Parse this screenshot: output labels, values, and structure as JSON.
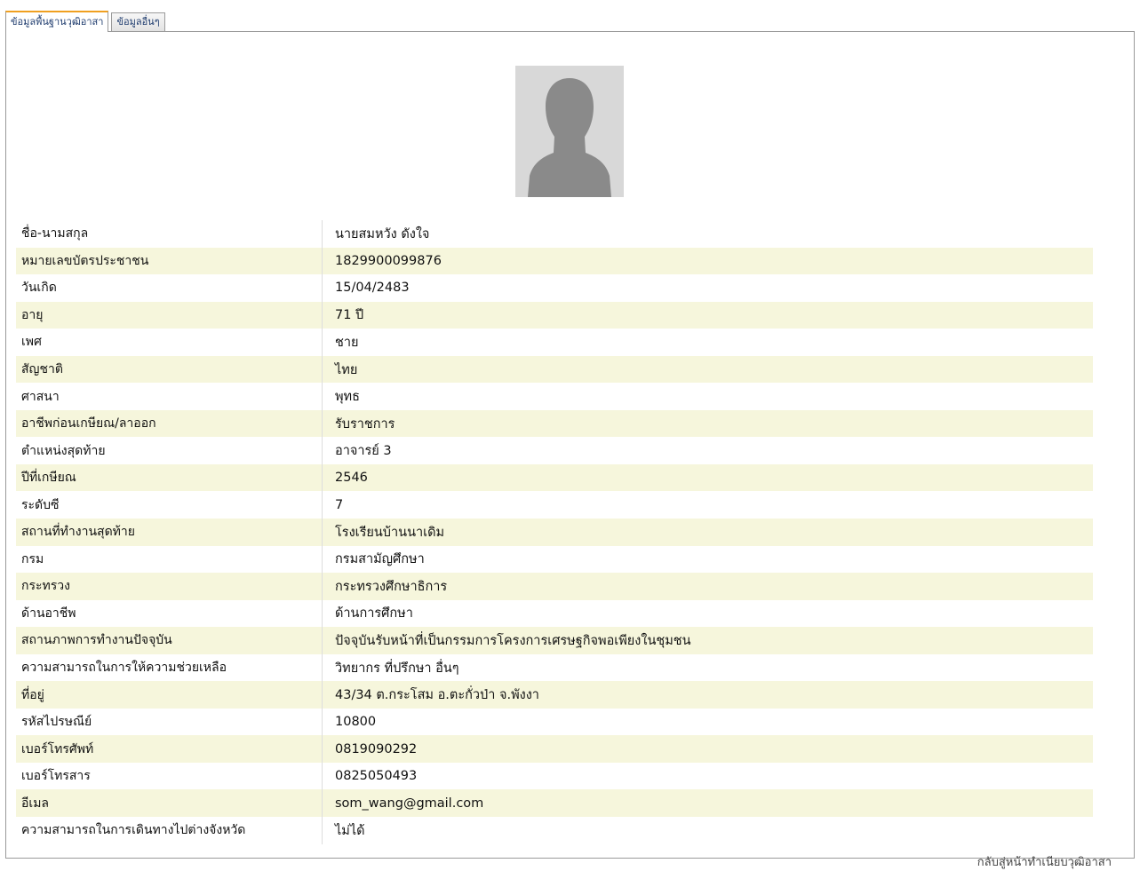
{
  "tabs": [
    {
      "label": "ข้อมูลพื้นฐานวุฒิอาสา",
      "active": true
    },
    {
      "label": "ข้อมูลอื่นๆ",
      "active": false
    }
  ],
  "profile": {
    "rows": [
      {
        "label": "ชื่อ-นามสกุล",
        "value": "นายสมหวัง ดังใจ"
      },
      {
        "label": "หมายเลขบัตรประชาชน",
        "value": "1829900099876"
      },
      {
        "label": "วันเกิด",
        "value": "15/04/2483"
      },
      {
        "label": "อายุ",
        "value": "71  ปี"
      },
      {
        "label": "เพศ",
        "value": "ชาย"
      },
      {
        "label": "สัญชาติ",
        "value": "ไทย"
      },
      {
        "label": "ศาสนา",
        "value": "พุทธ"
      },
      {
        "label": "อาชีพก่อนเกษียณ/ลาออก",
        "value": "รับราชการ"
      },
      {
        "label": "ตำแหน่งสุดท้าย",
        "value": "อาจารย์ 3"
      },
      {
        "label": "ปีที่เกษียณ",
        "value": "2546"
      },
      {
        "label": "ระดับซี",
        "value": "7"
      },
      {
        "label": "สถานที่ทำงานสุดท้าย",
        "value": "โรงเรียนบ้านนาเดิม"
      },
      {
        "label": "กรม",
        "value": "กรมสามัญศึกษา"
      },
      {
        "label": "กระทรวง",
        "value": "กระทรวงศึกษาธิการ"
      },
      {
        "label": "ด้านอาชีพ",
        "value": "ด้านการศึกษา"
      },
      {
        "label": "สถานภาพการทำงานปัจจุบัน",
        "value": "ปัจจุบันรับหน้าที่เป็นกรรมการโครงการเศรษฐกิจพอเพียงในชุมชน"
      },
      {
        "label": "ความสามารถในการให้ความช่วยเหลือ",
        "value": "วิทยากร ที่ปรึกษา อื่นๆ"
      },
      {
        "label": "ที่อยู่",
        "value": "43/34 ต.กระโสม อ.ตะกั่วป่า จ.พังงา"
      },
      {
        "label": "รหัสไปรษณีย์",
        "value": "10800"
      },
      {
        "label": "เบอร์โทรศัพท์",
        "value": "0819090292"
      },
      {
        "label": "เบอร์โทรสาร",
        "value": "0825050493"
      },
      {
        "label": "อีเมล",
        "value": "som_wang@gmail.com"
      },
      {
        "label": "ความสามารถในการเดินทางไปต่างจังหวัด",
        "value": "ไม่ได้"
      }
    ]
  },
  "footer": {
    "back_link": "กลับสู่หน้าทำเนียบวุฒิอาสา"
  },
  "colors": {
    "alt_row": "#f6f6dc",
    "tab_accent": "#f0a020"
  },
  "icons": {
    "photo": "avatar-placeholder-icon"
  }
}
